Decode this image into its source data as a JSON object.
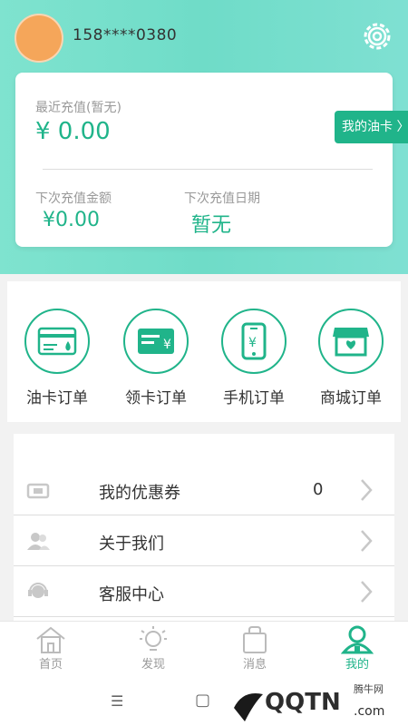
{
  "user": {
    "phone": "158****0380"
  },
  "card": {
    "recent_label": "最近充值(暂无)",
    "recent_amount": "¥ 0.00",
    "next_amount_label": "下次充值金额",
    "next_amount": "¥0.00",
    "next_date_label": "下次充值日期",
    "next_date": "暂无",
    "oilcard_button": "我的油卡 〉"
  },
  "shortcuts": [
    {
      "label": "油卡订单",
      "icon": "oil-card-icon"
    },
    {
      "label": "领卡订单",
      "icon": "card-yuan-icon"
    },
    {
      "label": "手机订单",
      "icon": "phone-yuan-icon"
    },
    {
      "label": "商城订单",
      "icon": "shop-icon"
    }
  ],
  "menu": [
    {
      "label": "我的优惠券",
      "count": "0",
      "icon": "coupon-icon"
    },
    {
      "label": "关于我们",
      "icon": "users-icon"
    },
    {
      "label": "客服中心",
      "icon": "headset-icon"
    }
  ],
  "tabs": [
    {
      "label": "首页",
      "icon": "home-icon"
    },
    {
      "label": "发现",
      "icon": "bulb-icon"
    },
    {
      "label": "消息",
      "icon": "bag-icon"
    },
    {
      "label": "我的",
      "icon": "person-icon",
      "active": true
    }
  ],
  "system_nav": {
    "menu_glyph": "☰",
    "home_glyph": "▢"
  },
  "watermark": {
    "text": "腾牛网",
    "logo_text": "QQTN.com"
  },
  "colors": {
    "accent": "#20b48a",
    "header": "#72ddc9",
    "avatar": "#f5a65a"
  }
}
